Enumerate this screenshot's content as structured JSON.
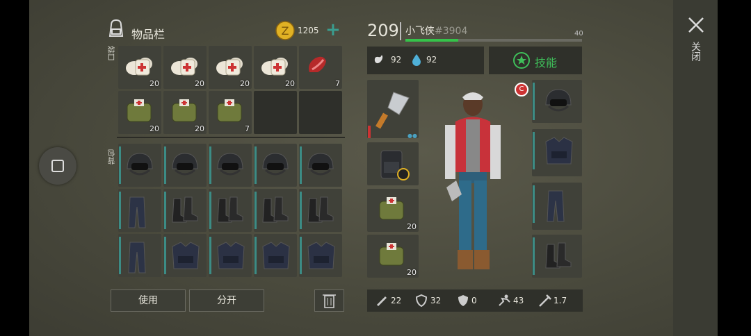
{
  "inventory": {
    "title": "物品栏",
    "coins": "1205",
    "pocket_label": "口袋",
    "backpack_label": "背包"
  },
  "pocket": [
    {
      "icon": "bandage-icon",
      "qty": "20"
    },
    {
      "icon": "bandage-icon",
      "qty": "20"
    },
    {
      "icon": "bandage-icon",
      "qty": "20"
    },
    {
      "icon": "bandage-icon",
      "qty": "20"
    },
    {
      "icon": "raw-meat-icon",
      "qty": "7"
    },
    {
      "icon": "medkit-bag-icon",
      "qty": "20"
    },
    {
      "icon": "medkit-bag-icon",
      "qty": "20"
    },
    {
      "icon": "medkit-bag-icon",
      "qty": "7"
    },
    {
      "icon": "empty",
      "qty": ""
    },
    {
      "icon": "empty",
      "qty": ""
    }
  ],
  "backpack": [
    "helmet-icon",
    "helmet-icon",
    "helmet-icon",
    "helmet-icon",
    "helmet-icon",
    "pants-icon",
    "boots-icon",
    "boots-icon",
    "boots-icon",
    "boots-icon",
    "pants-icon",
    "vest-icon",
    "vest-icon",
    "vest-icon",
    "vest-icon"
  ],
  "buttons": {
    "use": "使用",
    "split": "分开"
  },
  "player": {
    "level": "209",
    "name": "小飞侠",
    "id": "#3904",
    "xp_max": "40",
    "xp_fraction": 0.3,
    "food": "92",
    "water": "92",
    "skills": "技能"
  },
  "equipment": {
    "weapon_icon": "cleaver-icon",
    "bag_icon": "backpack-icon",
    "quick1_qty": "20",
    "quick2_qty": "20",
    "badge": "C"
  },
  "stats": {
    "attack": "22",
    "armor": "32",
    "resist": "0",
    "speed": "43",
    "weapon_speed": "1.7"
  },
  "close_label": "关闭",
  "colors": {
    "accent": "#3a9c8e",
    "xp": "#35c34a",
    "skills_green": "#3fbf5a",
    "coin": "#e0b124"
  }
}
